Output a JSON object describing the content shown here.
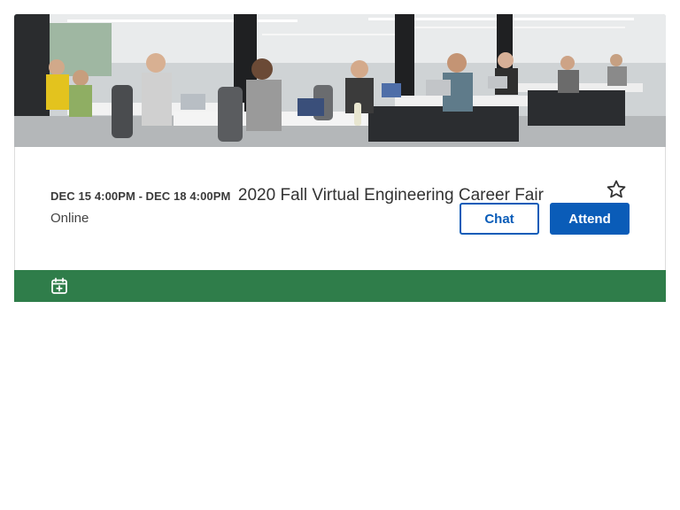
{
  "event": {
    "date_range_start": "DEC 15 4:00PM",
    "date_separator": " - ",
    "date_range_end": "DEC 18 4:00PM",
    "title": "2020 Fall Virtual Engineering Career Fair",
    "location": "Online"
  },
  "actions": {
    "chat_label": "Chat",
    "attend_label": "Attend",
    "favorite_icon": "star-outline-icon",
    "calendar_icon": "calendar-add-icon"
  },
  "banner": {
    "image_subject": "students working on laptops in an open-plan room"
  },
  "colors": {
    "primary": "#0a5cb8",
    "footer": "#2f7d4a"
  }
}
